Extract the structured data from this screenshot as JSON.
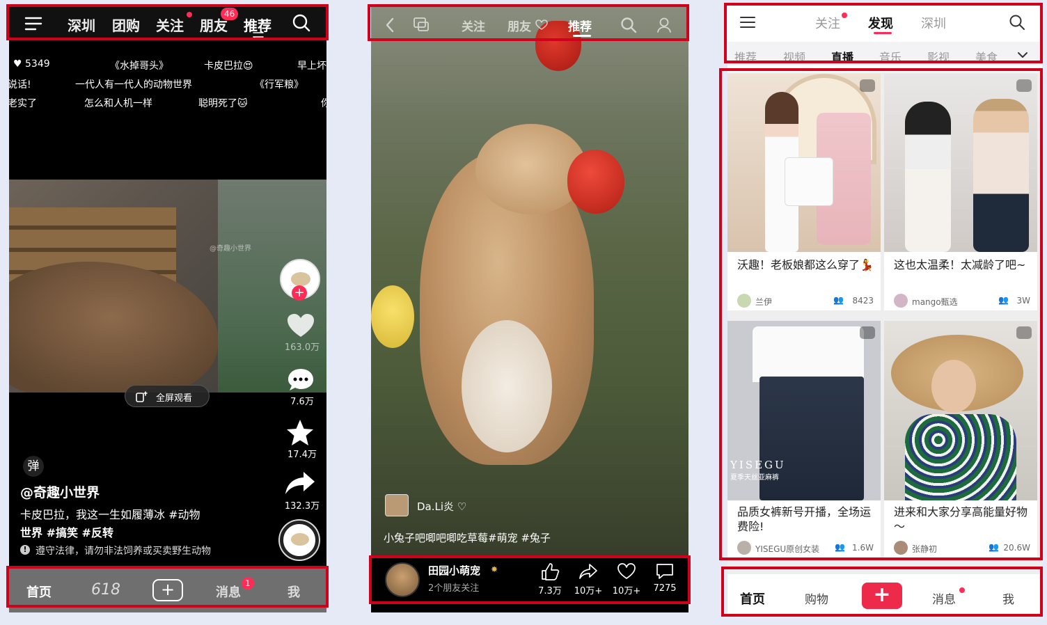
{
  "screen1": {
    "top_tabs": [
      "深圳",
      "团购",
      "关注",
      "朋友",
      "推荐"
    ],
    "friends_badge": "46",
    "danmaku": [
      {
        "text": "♥ 5349"
      },
      {
        "text": "《水掉哥头》"
      },
      {
        "text": "卡皮巴拉😍"
      },
      {
        "text": "早上坏"
      },
      {
        "text": "说话!"
      },
      {
        "text": "一代人有一代人的动物世界"
      },
      {
        "text": "《行军粮》"
      },
      {
        "text": "老实了"
      },
      {
        "text": "怎么和人机一样"
      },
      {
        "text": "聪明死了🐱"
      },
      {
        "text": "你"
      }
    ],
    "video_watermark": "@奇趣小世界",
    "fullscreen_label": "全屏观看",
    "likes": "163.0万",
    "comments": "7.6万",
    "favorites": "17.4万",
    "shares": "132.3万",
    "danmu_toggle": "弹",
    "author": "@奇趣小世界",
    "caption_line1": "卡皮巴拉，我这一生如履薄冰 #动物",
    "caption_line2": "世界 #搞笑 #反转",
    "notice": "遵守法律，请勿非法饲养或买卖野生动物",
    "bottom_nav": [
      "首页",
      "618",
      "+",
      "消息",
      "我"
    ],
    "messages_badge": "1"
  },
  "screen2": {
    "top_tabs": [
      "关注",
      "朋友",
      "推荐"
    ],
    "author_handle": "Da.Li炎 ♡",
    "caption": "小兔子吧唧吧唧吃草莓#萌宠 #兔子",
    "channel_name": "田园小萌宠",
    "friends_follow": "2个朋友关注",
    "actions": [
      {
        "icon": "thumb-up-icon",
        "value": "7.3万"
      },
      {
        "icon": "share-icon",
        "value": "10万+"
      },
      {
        "icon": "heart-icon",
        "value": "10万+"
      },
      {
        "icon": "comment-icon",
        "value": "7275"
      }
    ]
  },
  "screen3": {
    "top_tabs": [
      "关注",
      "发现",
      "深圳"
    ],
    "active_tab": "发现",
    "categories": [
      "推荐",
      "视频",
      "直播",
      "音乐",
      "影视",
      "美食"
    ],
    "active_category": "直播",
    "cards": [
      {
        "title": "沃趣！老板娘都这么穿了💃",
        "author": "兰伊",
        "viewers": "8423"
      },
      {
        "title": "这也太温柔！太减龄了吧~",
        "author": "mango甄选",
        "viewers": "3W"
      },
      {
        "title": "品质女裤新号开播，全场运费险!",
        "author": "YISEGU原创女装",
        "viewers": "1.6W",
        "brand": "YISEGU",
        "brand_sub": "夏季天丝亚麻裤"
      },
      {
        "title": "进来和大家分享高能量好物～",
        "author": "张静初",
        "viewers": "20.6W"
      }
    ],
    "bottom_nav": [
      "首页",
      "购物",
      "+",
      "消息",
      "我"
    ]
  },
  "colors": {
    "highlight": "#d0021b",
    "accent": "#ff2d55",
    "background": "#e6eaf7"
  }
}
